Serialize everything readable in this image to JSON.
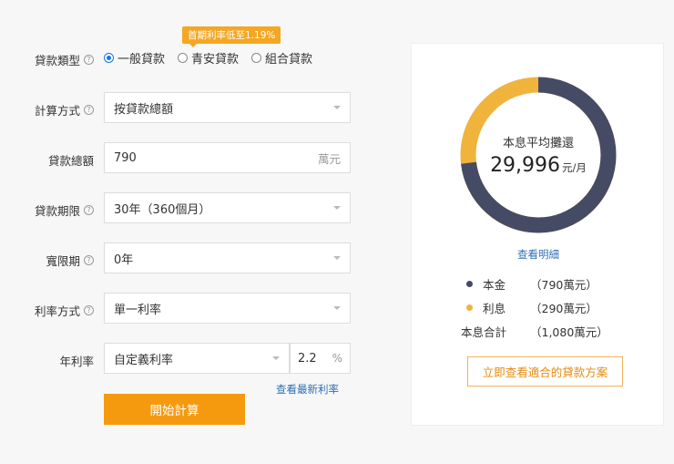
{
  "promo": "首期利率低至1.19%",
  "loan_type": {
    "label": "貸款類型",
    "options": [
      "一般貸款",
      "青安貸款",
      "組合貸款"
    ],
    "selected_index": 0
  },
  "calc_method": {
    "label": "計算方式",
    "value": "按貸款總額"
  },
  "loan_amount": {
    "label": "貸款總額",
    "value": "790",
    "unit": "萬元"
  },
  "loan_term": {
    "label": "貸款期限",
    "value": "30年（360個月）"
  },
  "grace_period": {
    "label": "寬限期",
    "value": "0年"
  },
  "rate_mode": {
    "label": "利率方式",
    "value": "單一利率"
  },
  "annual_rate": {
    "label": "年利率",
    "select_value": "自定義利率",
    "value": "2.2",
    "unit": "%",
    "latest_link": "查看最新利率"
  },
  "start_button": "開始計算",
  "result": {
    "monthly_label": "本息平均攤還",
    "monthly_amount": "29,996",
    "monthly_unit": "元/月",
    "detail_link": "查看明細",
    "principal": {
      "label": "本金",
      "value": "（790萬元）",
      "color": "#454b64",
      "amount": 790
    },
    "interest": {
      "label": "利息",
      "value": "（290萬元）",
      "color": "#f0b33c",
      "amount": 290
    },
    "total": {
      "label": "本息合計",
      "value": "（1,080萬元）"
    },
    "plan_button": "立即查看適合的貸款方案"
  },
  "colors": {
    "accent": "#f59a0f",
    "link": "#2f6fb3",
    "radio": "#1a73e8"
  }
}
